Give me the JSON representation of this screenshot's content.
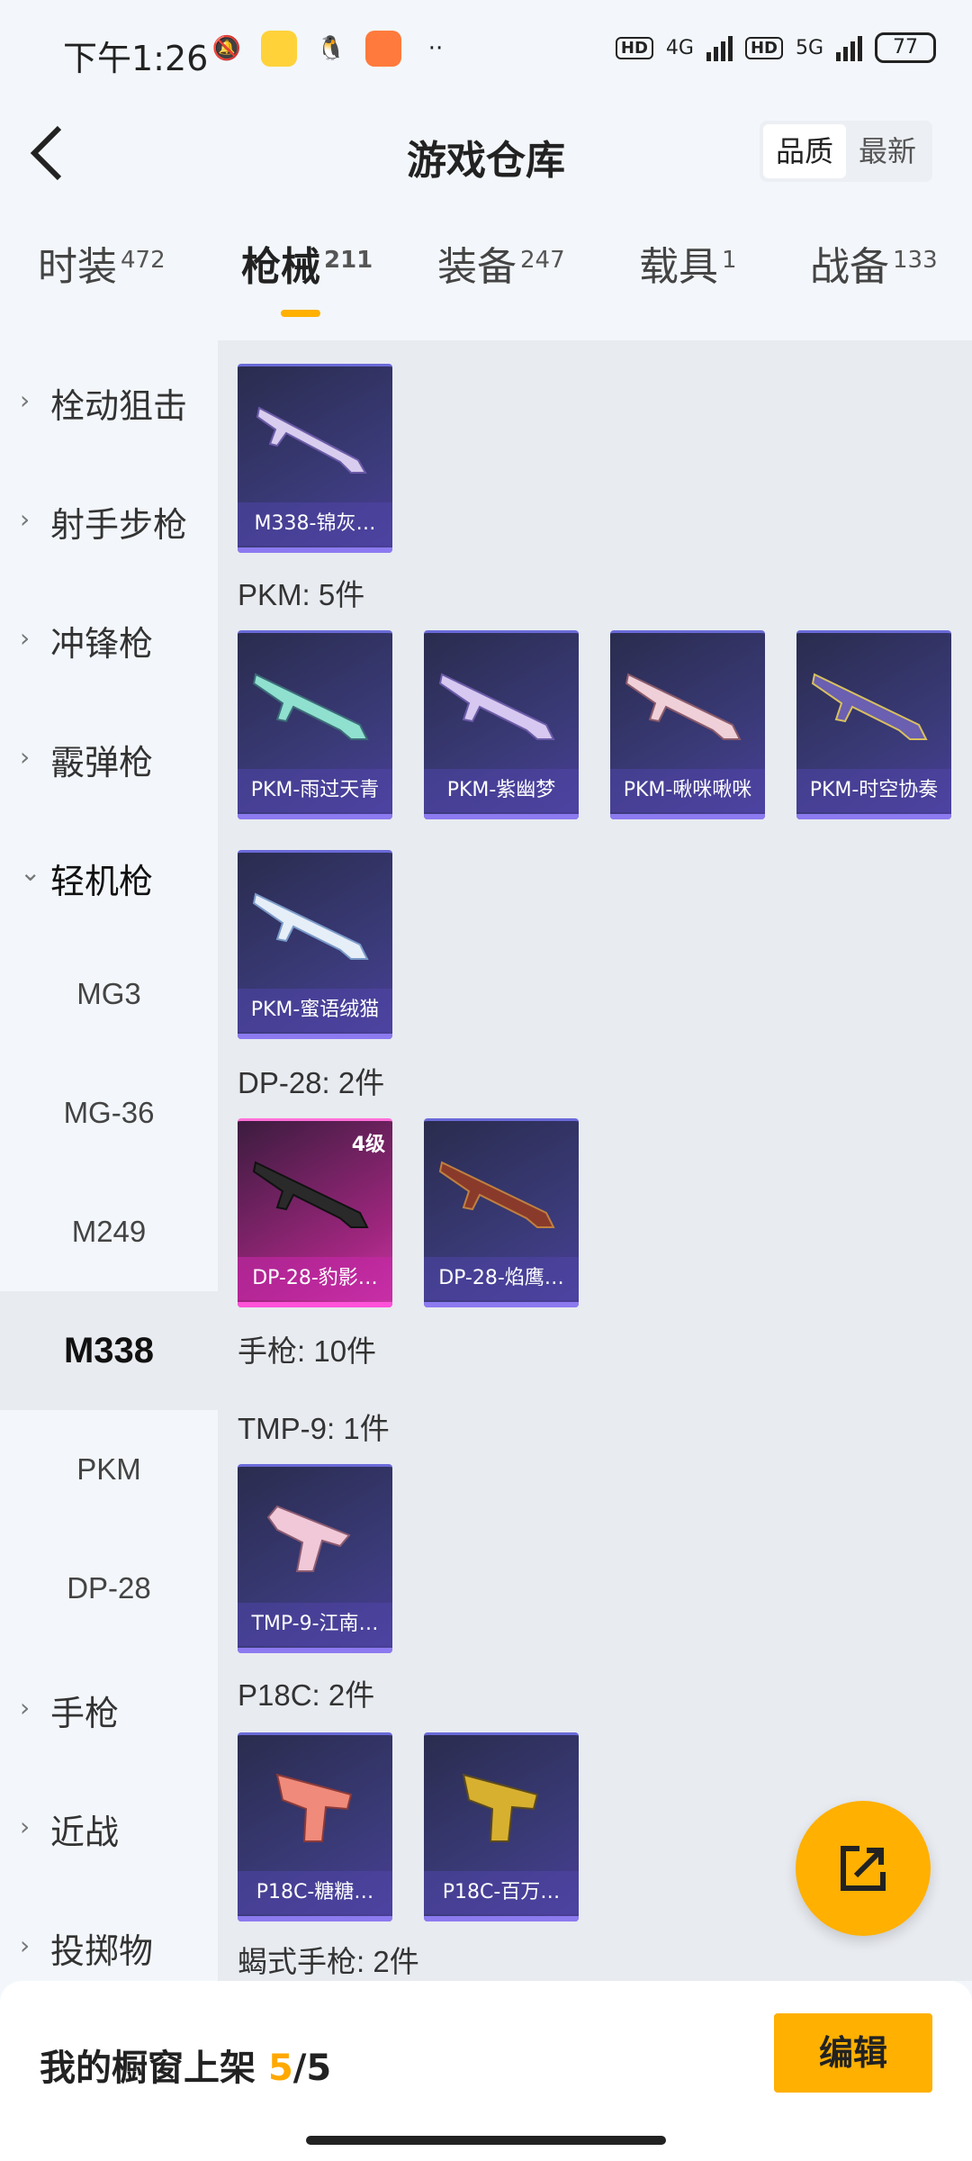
{
  "status_bar": {
    "time": "下午1:26",
    "network1": "4G",
    "network2": "5G",
    "battery": "77"
  },
  "header": {
    "title": "游戏仓库",
    "sort_options": [
      "品质",
      "最新"
    ]
  },
  "tabs": [
    {
      "label": "时装",
      "count": "472"
    },
    {
      "label": "枪械",
      "count": "211"
    },
    {
      "label": "装备",
      "count": "247"
    },
    {
      "label": "载具",
      "count": "1"
    },
    {
      "label": "战备",
      "count": "133"
    }
  ],
  "sidebar": {
    "categories_top": [
      "栓动狙击",
      "射手步枪",
      "冲锋枪",
      "霰弹枪"
    ],
    "open_category": "轻机枪",
    "subitems": [
      "MG3",
      "MG-36",
      "M249",
      "M338",
      "PKM",
      "DP-28"
    ],
    "categories_bottom": [
      "手枪",
      "近战",
      "投掷物"
    ]
  },
  "content": {
    "m338_items": [
      "M338-锦灰…"
    ],
    "pkm_header": "PKM: 5件",
    "pkm_items": [
      "PKM-雨过天青",
      "PKM-紫幽梦",
      "PKM-啾咪啾咪",
      "PKM-时空协奏",
      "PKM-蜜语绒猫"
    ],
    "dp28_header": "DP-28: 2件",
    "dp28_items": [
      "DP-28-豹影…",
      "DP-28-焰鹰…"
    ],
    "dp28_level": "4级",
    "pistol_header": "手枪: 10件",
    "tmp9_header": "TMP-9: 1件",
    "tmp9_items": [
      "TMP-9-江南…"
    ],
    "p18c_header": "P18C: 2件",
    "p18c_items": [
      "P18C-糖糖…",
      "P18C-百万…"
    ],
    "scorpion_header": "蝎式手枪: 2件"
  },
  "bottom": {
    "shelf_label": "我的橱窗上架 ",
    "shelf_current": "5",
    "shelf_total": "/5",
    "edit_label": "编辑"
  },
  "colors": {
    "accent": "#ffb000",
    "card_purple": "#3a3a78",
    "card_pink": "#c93aa5"
  }
}
